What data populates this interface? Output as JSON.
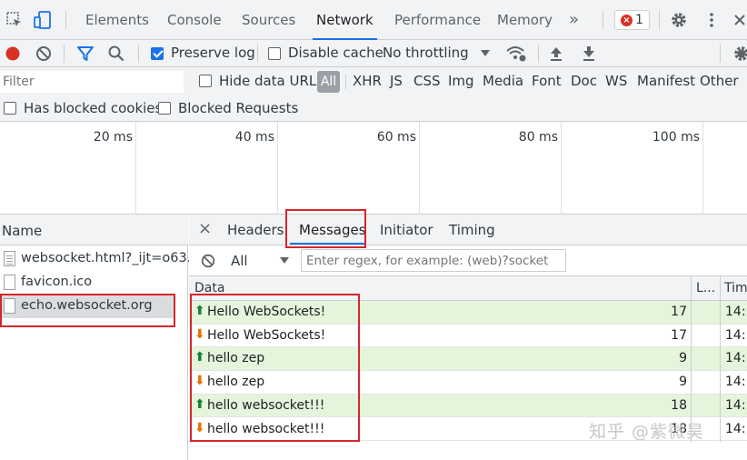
{
  "devtools": {
    "tabs": [
      "Elements",
      "Console",
      "Sources",
      "Network",
      "Performance",
      "Memory"
    ],
    "active_tab": "Network",
    "more_tabs_glyph": "»",
    "error_count": "1"
  },
  "toolbar": {
    "preserve_log": "Preserve log",
    "disable_cache": "Disable cache",
    "throttling": "No throttling"
  },
  "filter": {
    "placeholder": "Filter",
    "hide_data_urls": "Hide data URLs",
    "types": [
      "All",
      "XHR",
      "JS",
      "CSS",
      "Img",
      "Media",
      "Font",
      "Doc",
      "WS",
      "Manifest",
      "Other"
    ],
    "has_blocked_cookies": "Has blocked cookies",
    "blocked_requests": "Blocked Requests"
  },
  "timeline": {
    "ticks": [
      "20 ms",
      "40 ms",
      "60 ms",
      "80 ms",
      "100 ms"
    ]
  },
  "requests": {
    "header": "Name",
    "items": [
      "websocket.html?_ijt=o63...",
      "favicon.ico",
      "echo.websocket.org"
    ]
  },
  "detail": {
    "close_glyph": "×",
    "tabs": [
      "Headers",
      "Messages",
      "Initiator",
      "Timing"
    ],
    "filter_select": "All",
    "regex_placeholder": "Enter regex, for example: (web)?socket",
    "columns": {
      "data": "Data",
      "length": "L...",
      "time": "Tim"
    },
    "messages": [
      {
        "dir": "up",
        "text": "Hello WebSockets!",
        "length": "17",
        "time": "14:.."
      },
      {
        "dir": "down",
        "text": "Hello WebSockets!",
        "length": "17",
        "time": "14:.."
      },
      {
        "dir": "up",
        "text": "hello zep",
        "length": "9",
        "time": "14:.."
      },
      {
        "dir": "down",
        "text": "hello zep",
        "length": "9",
        "time": "14:.."
      },
      {
        "dir": "up",
        "text": "hello websocket!!!",
        "length": "18",
        "time": "14:.."
      },
      {
        "dir": "down",
        "text": "hello websocket!!!",
        "length": "18",
        "time": "14:.."
      }
    ]
  },
  "watermark": "知乎 @紫微昊"
}
